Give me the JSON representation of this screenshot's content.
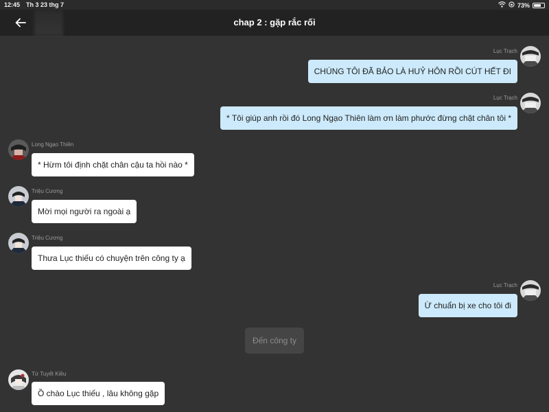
{
  "status": {
    "time": "12:45",
    "date": "Th 3 23 thg 7",
    "battery": "73%",
    "battery_level": 0.73
  },
  "nav": {
    "title": "chap 2 : gặp rắc rối"
  },
  "messages": [
    {
      "sender": "Lục Trạch",
      "text": "CHÚNG TÔI ĐÃ BẢO LÀ HUỶ HÔN RỒI CÚT HẾT ĐI",
      "side": "right"
    },
    {
      "sender": "Lục Trạch",
      "text": "* Tôi giúp anh rồi đó Long Ngạo Thiên làm ơn làm phước đừng chặt chân tôi *",
      "side": "right"
    },
    {
      "sender": "Long Ngạo Thiên",
      "text": "* Hừm tôi định chặt chân cậu ta hồi nào *",
      "side": "left"
    },
    {
      "sender": "Triệu Cương",
      "text": "Mời mọi người ra ngoài ạ",
      "side": "left"
    },
    {
      "sender": "Triệu Cương",
      "text": "Thưa Lục thiếu có chuyện trên công ty ạ",
      "side": "left"
    },
    {
      "sender": "Lục Trạch",
      "text": "Ừ chuẩn bị xe cho tôi đi",
      "side": "right"
    },
    {
      "sender": "Từ Tuyết Kiều",
      "text": "Ồ chào Lục thiếu , lâu không gặp",
      "side": "left"
    }
  ],
  "scene_button": {
    "label": "Đến công ty"
  },
  "icons": {
    "back": "back-arrow-icon",
    "wifi": "wifi-icon",
    "lock": "orientation-lock-icon",
    "battery": "battery-icon"
  },
  "colors": {
    "background": "#333333",
    "nav": "#222222",
    "bubble_right": "#cceafb",
    "bubble_left": "#ffffff"
  }
}
